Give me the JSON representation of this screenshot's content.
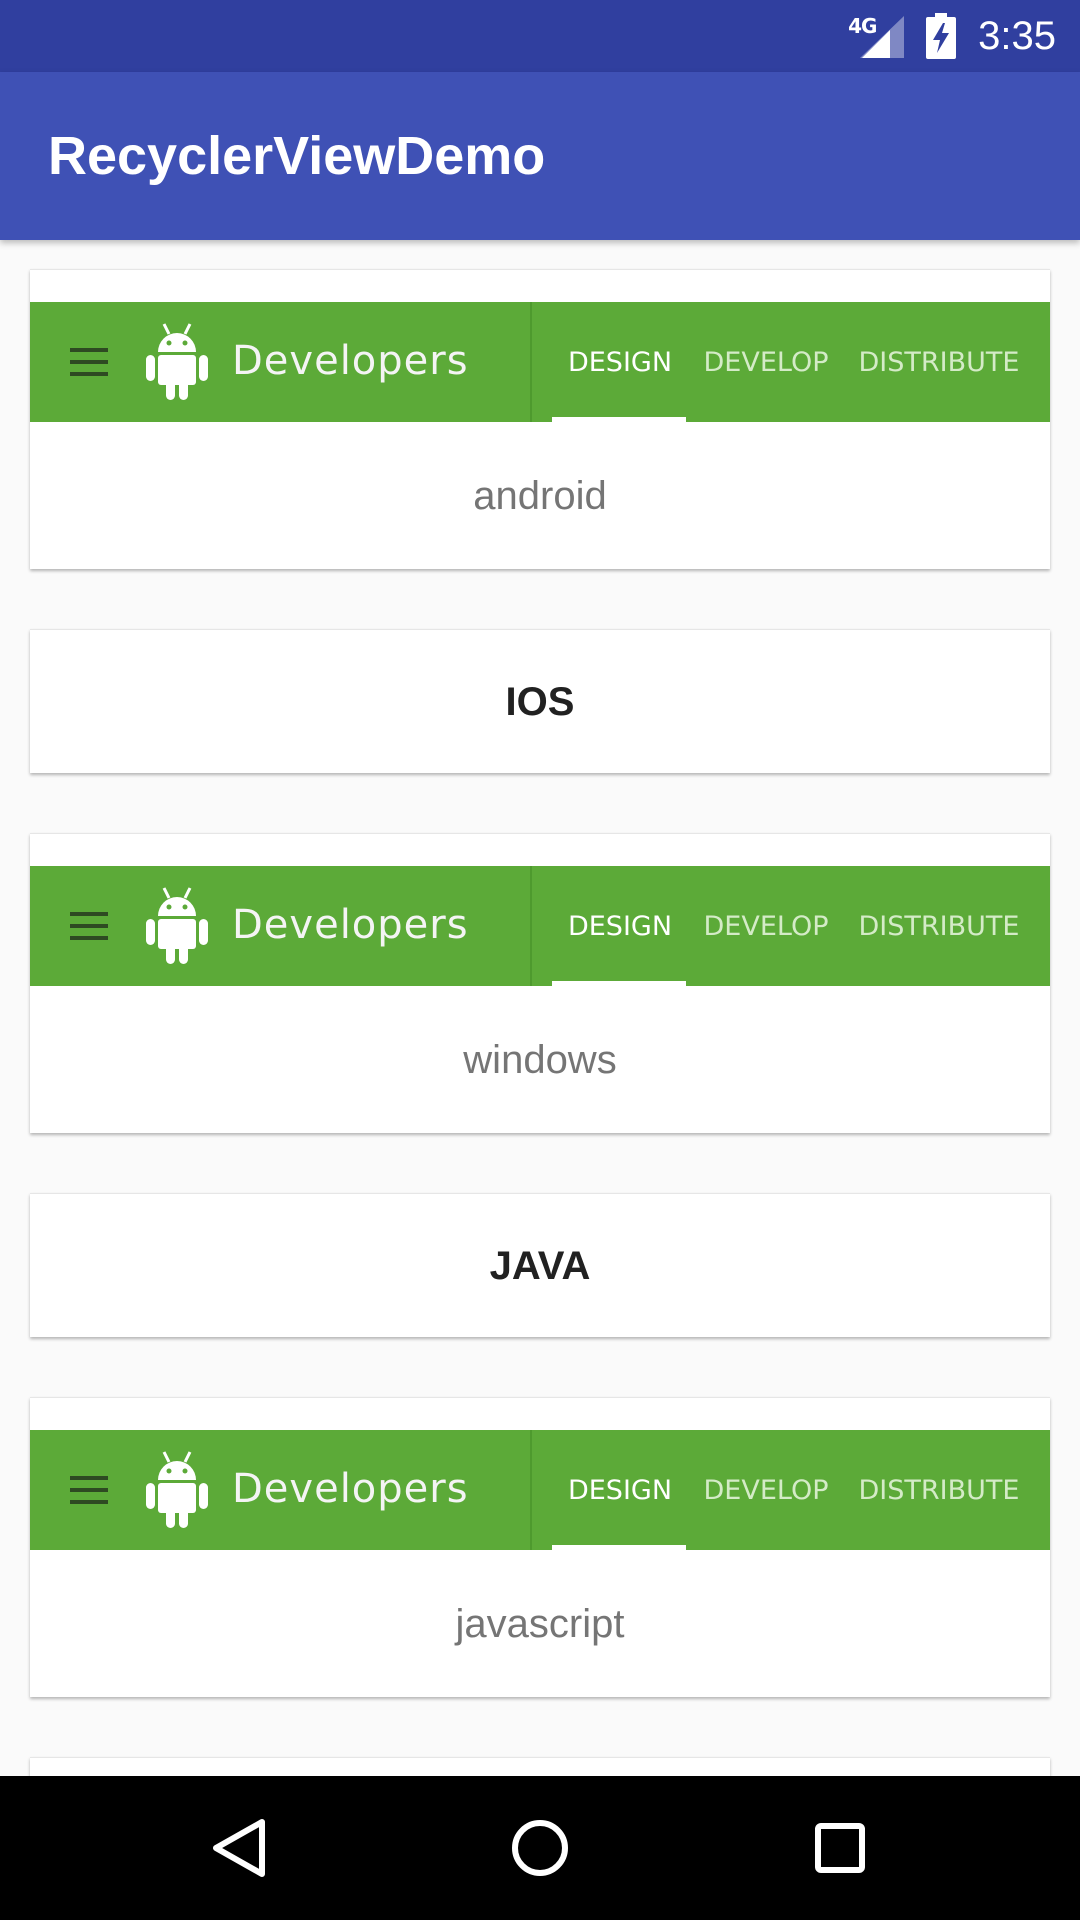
{
  "status_bar": {
    "network": "4G",
    "time": "3:35",
    "background": "#303f9f"
  },
  "app_bar": {
    "title": "RecyclerViewDemo",
    "background": "#3f51b5"
  },
  "banner": {
    "brand": "Developers",
    "tabs": [
      "DESIGN",
      "DEVELOP",
      "DISTRIBUTE"
    ],
    "active_tab": "DESIGN",
    "color": "#5caa38",
    "icons": [
      "menu-icon",
      "android-icon"
    ]
  },
  "list": {
    "items": [
      {
        "type": "image",
        "text": "android"
      },
      {
        "type": "text",
        "text": "IOS"
      },
      {
        "type": "image",
        "text": "windows"
      },
      {
        "type": "text",
        "text": "JAVA"
      },
      {
        "type": "image",
        "text": "javascript"
      }
    ]
  },
  "nav_bar": {
    "icons": [
      "back-icon",
      "home-icon",
      "recents-icon"
    ]
  }
}
